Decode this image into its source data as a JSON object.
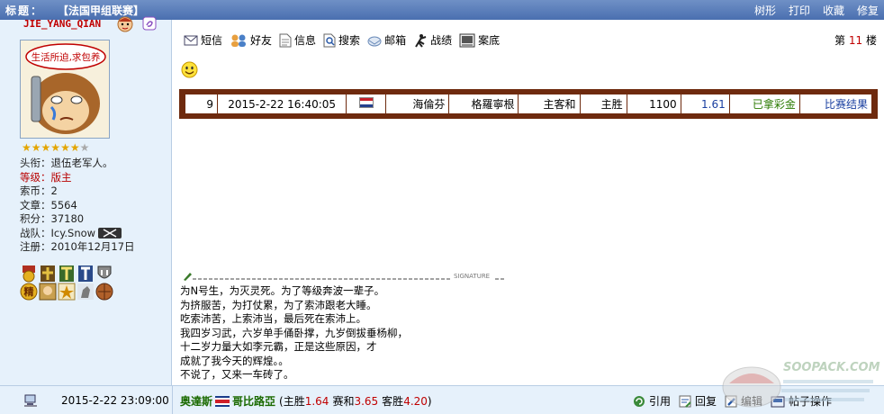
{
  "titlebar": {
    "label": "标题：",
    "title": "【法国甲组联赛】",
    "actions": [
      "树形",
      "打印",
      "收藏",
      "修复"
    ]
  },
  "user": {
    "name": "JIE_YANG_QIAN",
    "avatar_text": "生活所迫,求包养",
    "stars_filled": 6,
    "stars_total": 7,
    "info": [
      {
        "label": "头衔：",
        "value": "退伍老军人。"
      },
      {
        "label": "等级：",
        "value": "版主"
      },
      {
        "label": "索币：",
        "value": "2"
      },
      {
        "label": "文章：",
        "value": "5564"
      },
      {
        "label": "积分：",
        "value": "37180"
      },
      {
        "label": "战队：",
        "value": "Icy.Snow"
      },
      {
        "label": "注册：",
        "value": "2010年12月17日"
      }
    ],
    "medal_text": "精"
  },
  "toolbar": {
    "items": [
      "短信",
      "好友",
      "信息",
      "搜索",
      "邮箱",
      "战绩",
      "案底"
    ]
  },
  "floor": {
    "prefix": "第",
    "number": "11",
    "suffix": "楼"
  },
  "bet": {
    "num": "9",
    "datetime": "2015-2-22 16:40:05",
    "team": "海倫芬",
    "opponent": "格羅寧根",
    "pick": "主客和",
    "result": "主胜",
    "stake": "1100",
    "odds": "1.61",
    "status": "已拿彩金",
    "link": "比赛结果"
  },
  "signature": {
    "label": "SIGNATURE",
    "lines": [
      "为N号生，为灭灵死。为了等级奔波一辈子。",
      "为挤服苦，为打仗累，为了索沛跟老大睡。",
      "吃索沛苦，上索沛当，最后死在索沛上。",
      "我四岁习武，六岁单手俑卧撑，九岁倒拔垂杨柳，",
      "十二岁力量大如李元霸，正是这些原因，才",
      "成就了我今天的辉煌。。",
      "不说了，又来一车砖了。"
    ]
  },
  "footer": {
    "time": "2015-2-22 23:09:00",
    "home": "奥達斯",
    "away": "哥比路亞",
    "home_win_label": "(主胜",
    "home_win": "1.64",
    "draw_label": "赛和",
    "draw": "3.65",
    "away_win_label": "客胜",
    "away_win": "4.20",
    "close_paren": ")",
    "actions": [
      "引用",
      "回复",
      "编辑",
      "帖子操作"
    ]
  },
  "watermark": "SOOPACK.COM",
  "colors": {
    "titlebar": "#5a7fbd",
    "panel": "#e6f1fb",
    "betbox_border": "#6e2a0e",
    "red": "#c00000",
    "green": "#2a7a00",
    "blue": "#1a3fa0"
  }
}
